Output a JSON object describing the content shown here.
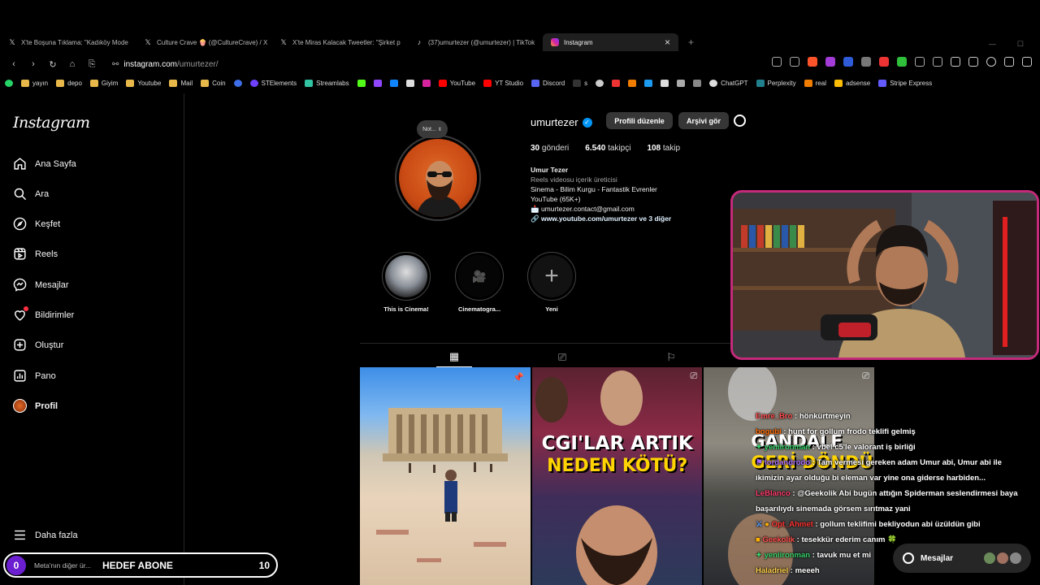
{
  "browser": {
    "tabs": [
      {
        "icon": "x-icon",
        "title": "X'te Boşuna Tıklama: \"Kadıköy Mode"
      },
      {
        "icon": "x-icon",
        "title": "Culture Crave 🍿 (@CultureCrave) / X"
      },
      {
        "icon": "x-icon",
        "title": "X'te Miras Kalacak Tweetler: \"Şirket p"
      },
      {
        "icon": "tiktok-icon",
        "title": "(37)umurtezer (@umurtezer) | TikTok"
      },
      {
        "icon": "instagram-icon",
        "title": "Instagram"
      }
    ],
    "close_glyph": "×",
    "new_tab_glyph": "+",
    "url_host": "instagram.com",
    "url_path": "/umurtezer/",
    "bookmarks": [
      "yayın",
      "depo",
      "Giyim",
      "Youtube",
      "Mail",
      "Coin",
      "STElements",
      "Streamlabs",
      "YouTube",
      "YT Studio",
      "Discord",
      "s",
      "ChatGPT",
      "Perplexity",
      "real",
      "adsense",
      "Stripe Express"
    ]
  },
  "sidebar": {
    "logo": "Instagram",
    "items": [
      {
        "label": "Ana Sayfa",
        "icon": "home-icon"
      },
      {
        "label": "Ara",
        "icon": "search-icon"
      },
      {
        "label": "Keşfet",
        "icon": "compass-icon"
      },
      {
        "label": "Reels",
        "icon": "reels-icon"
      },
      {
        "label": "Mesajlar",
        "icon": "messenger-icon"
      },
      {
        "label": "Bildirimler",
        "icon": "heart-icon"
      },
      {
        "label": "Oluştur",
        "icon": "plus-square-icon"
      },
      {
        "label": "Pano",
        "icon": "dashboard-icon"
      },
      {
        "label": "Profil",
        "icon": "avatar"
      }
    ],
    "more": "Daha fazla",
    "meta": "Meta'nın diğer ür..."
  },
  "profile": {
    "note": "Not...",
    "username": "umurtezer",
    "edit_button": "Profili düzenle",
    "archive_button": "Arşivi gör",
    "stats": {
      "posts": "30",
      "posts_label": "gönderi",
      "followers": "6.540",
      "followers_label": "takipçi",
      "following": "108",
      "following_label": "takip"
    },
    "bio": {
      "name": "Umur Tezer",
      "category": "Reels videosu içerik üreticisi",
      "line1": "Sinema - Bilim Kurgu - Fantastik Evrenler",
      "line2": "YouTube (65K+)",
      "email": "📩 umurtezer.contact@gmail.com",
      "link": "www.youtube.com/umurtezer ve 3 diğer"
    },
    "highlights": [
      {
        "title": "This is Cinema!"
      },
      {
        "title": "Cinematogra..."
      },
      {
        "title": "Yeni"
      }
    ]
  },
  "posts": [
    {
      "overlay": ""
    },
    {
      "overlay_line1": "CGI'LAR ARTIK",
      "overlay_line2": "NEDEN KÖTÜ?"
    },
    {
      "overlay_line1": "GANDALF",
      "overlay_line2": "GERİ DÖNDÜ"
    }
  ],
  "chat": [
    {
      "user": "Emre_Bro",
      "color": "#ff4d4d",
      "text": " : hönkürtmeyin"
    },
    {
      "user": "bogubi",
      "color": "#ff6a00",
      "text": " : hunt for gollum frodo teklifi gelmiş"
    },
    {
      "user": "yeniironman",
      "color": "#36d36b",
      "text": " : vbel c5'le valorant iş birliği"
    },
    {
      "user": "lordandrodo",
      "color": "#a66bff",
      "text": " : Tam vermesi gereken adam Umur abi, Umur abi ile ikimizin ayar olduğu bi eleman var yine ona giderse harbiden..."
    },
    {
      "user": "LeBlanco",
      "color": "#ff3b6b",
      "text": " : @Geekolik Abi bugün attığın Spiderman seslendirmesi baya başarılıydı sinemada görsem sırıtmaz yani"
    },
    {
      "user": "Opt_Ahmet",
      "color": "#ff3333",
      "text": " : gollum teklifimi bekliyodun abi üzüldün gibi"
    },
    {
      "user": "Geekolik",
      "color": "#ff4d4d",
      "text": " : tesekkür ederim canım 🍀"
    },
    {
      "user": "yeniironman",
      "color": "#36d36b",
      "text": " : tavuk mu et mi"
    },
    {
      "user": "Haladriel",
      "color": "#ffd24a",
      "text": " : meeeh"
    }
  ],
  "messages_button": "Mesajlar",
  "goal": {
    "start": "0",
    "label": "HEDEF ABONE",
    "target": "10"
  }
}
